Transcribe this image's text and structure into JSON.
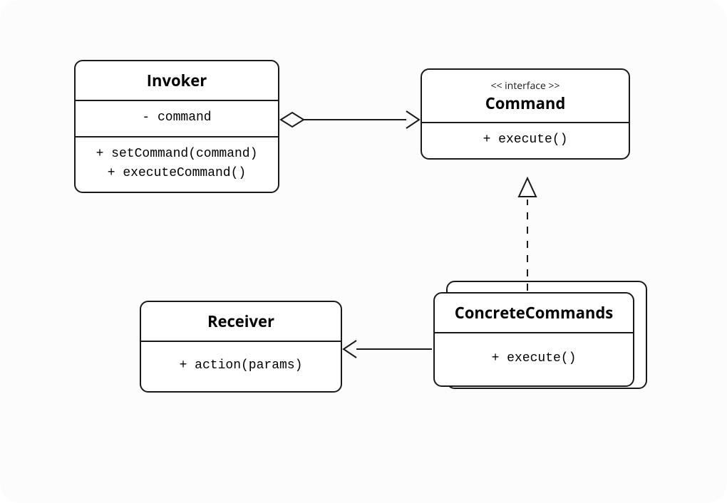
{
  "diagram": {
    "invoker": {
      "title": "Invoker",
      "field_command": "- command",
      "op_setCommand": "+ setCommand(command)",
      "op_executeCommand": "+ executeCommand()"
    },
    "command": {
      "stereotype": "<< interface >>",
      "title": "Command",
      "op_execute": "+ execute()"
    },
    "concrete": {
      "title": "ConcreteCommands",
      "op_execute": "+ execute()"
    },
    "receiver": {
      "title": "Receiver",
      "op_action": "+ action(params)"
    }
  },
  "relations": [
    {
      "kind": "aggregation",
      "from": "Invoker",
      "to": "Command",
      "head": "open-arrow",
      "tail": "diamond"
    },
    {
      "kind": "realization",
      "from": "ConcreteCommands",
      "to": "Command",
      "head": "hollow-triangle",
      "style": "dashed"
    },
    {
      "kind": "association",
      "from": "ConcreteCommands",
      "to": "Receiver",
      "head": "open-arrow"
    }
  ],
  "colors": {
    "stroke": "#1a1a1a",
    "fill": "#ffffff",
    "bg": "#fcfcfc"
  }
}
